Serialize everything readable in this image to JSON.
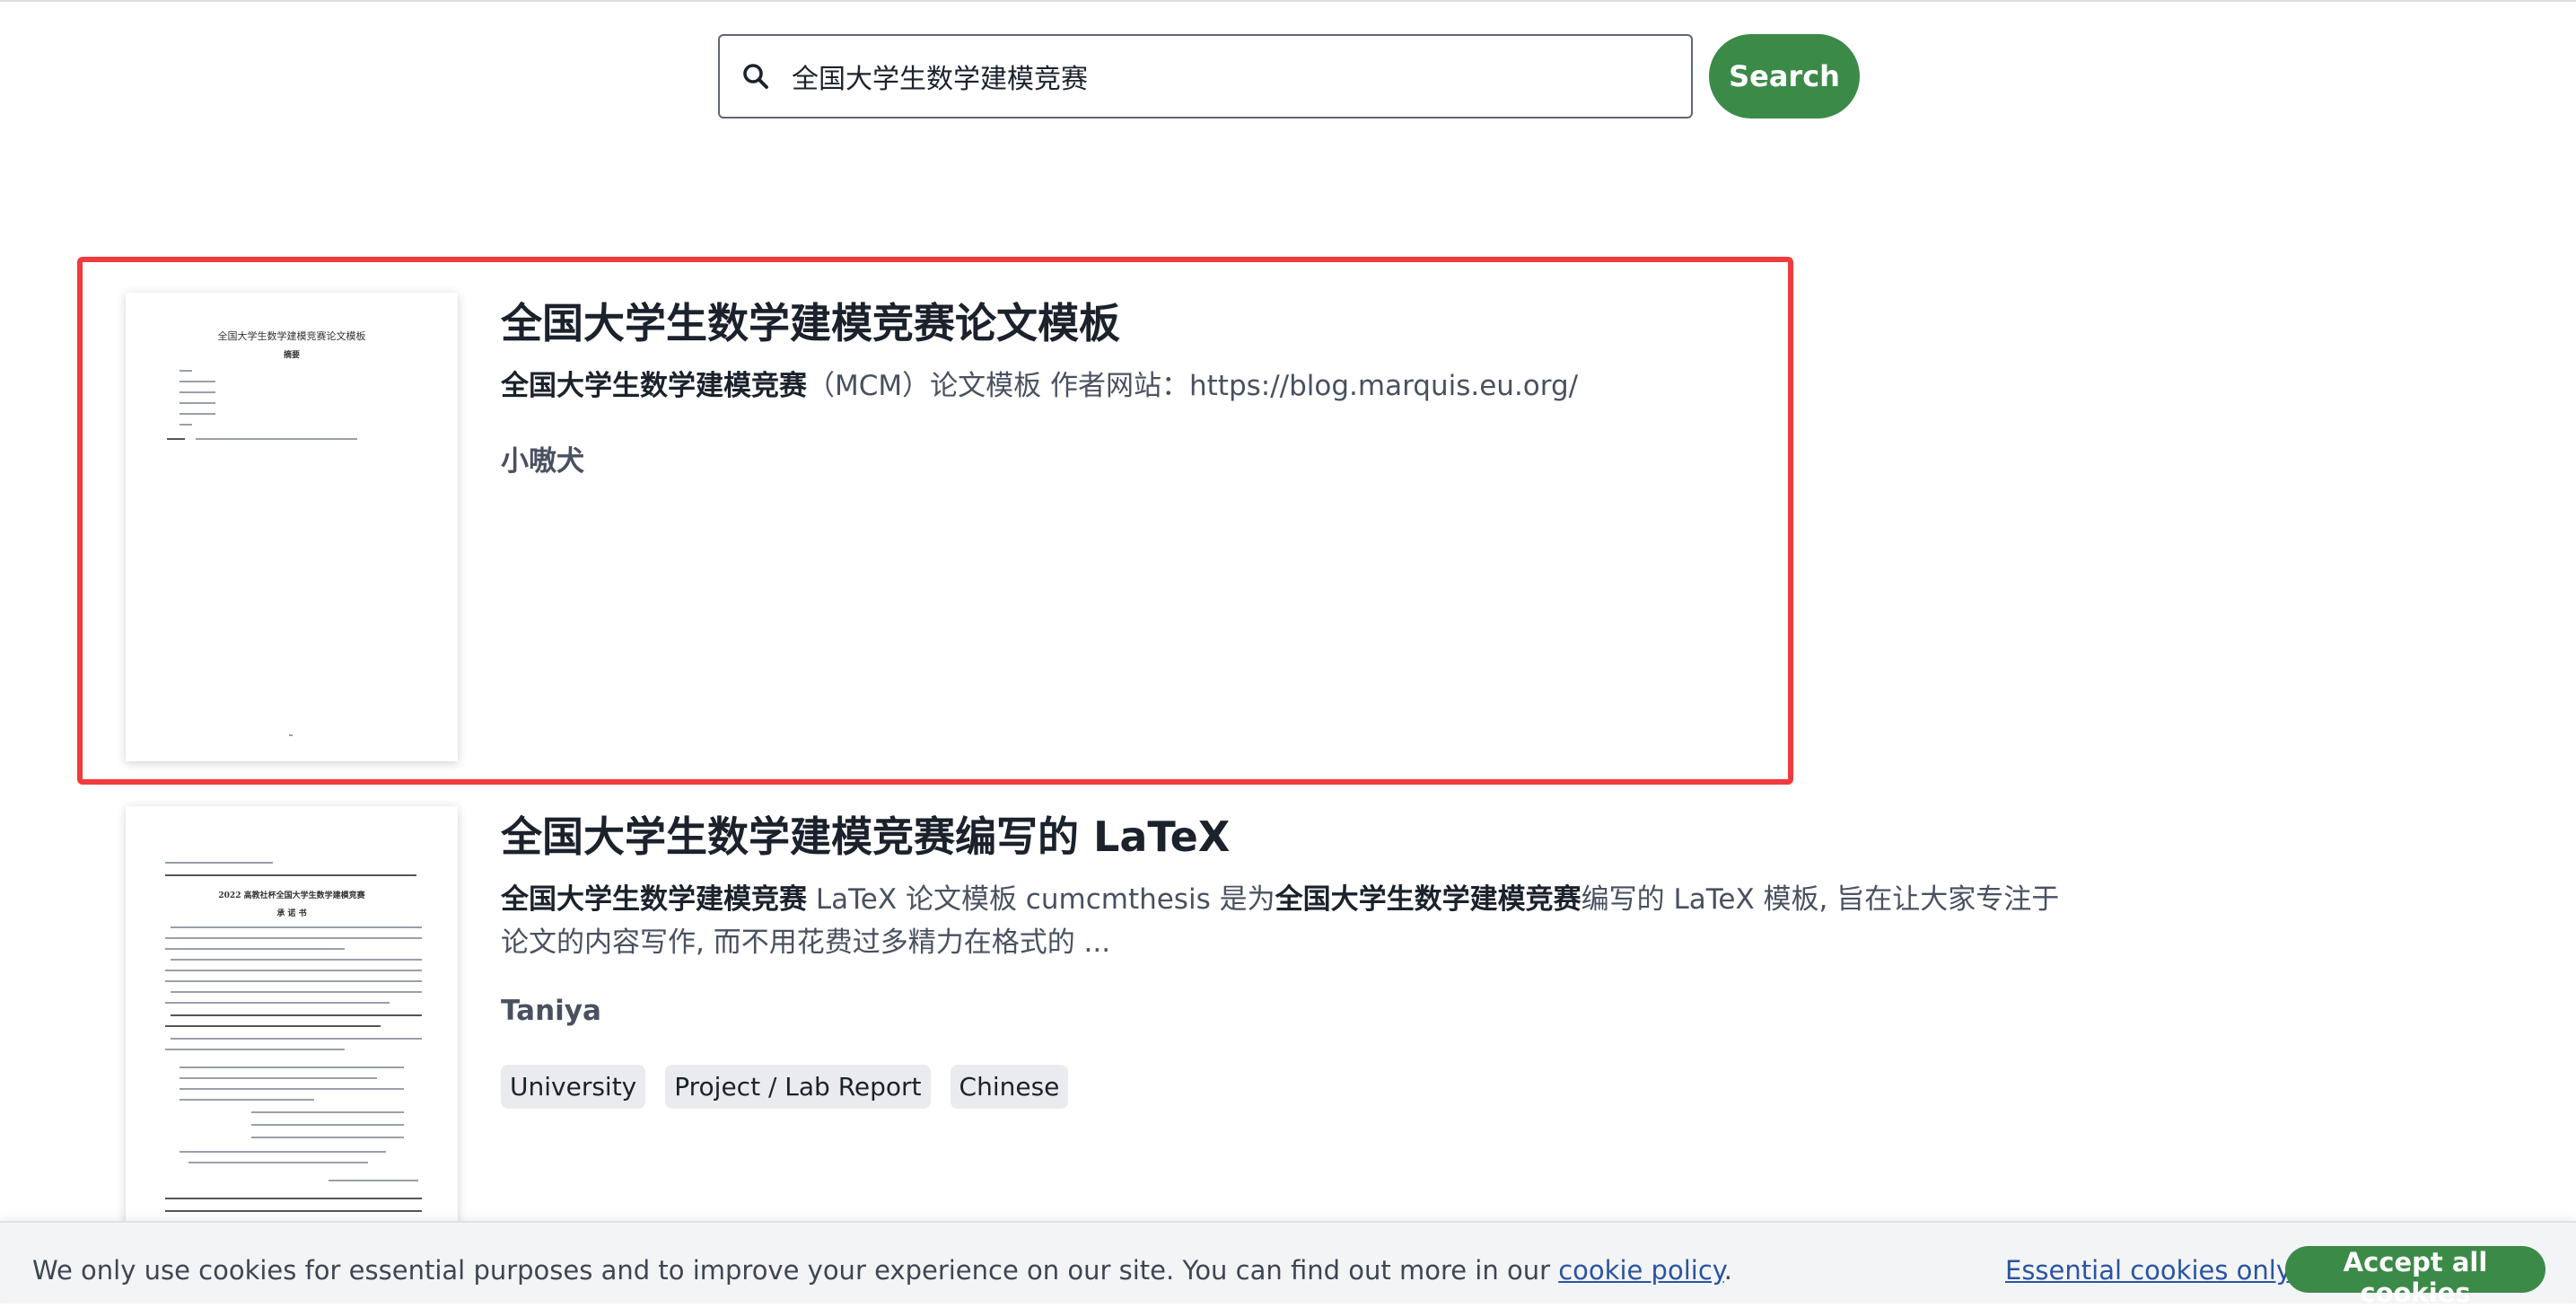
{
  "search": {
    "query": "全国大学生数学建模竞赛",
    "button_label": "Search"
  },
  "results": [
    {
      "title": "全国大学生数学建模竞赛论文模板",
      "description_bold": "全国大学生数学建模竞赛",
      "description_rest": "（MCM）论文模板 作者网站：https://blog.marquis.eu.org/",
      "author": "小嗷犬",
      "thumbnail_heading": "全国大学生数学建模竞赛论文模板",
      "thumbnail_subheading": "摘要"
    },
    {
      "title": "全国大学生数学建模竞赛编写的 LaTeX",
      "description_part1_bold": "全国大学生数学建模竞赛",
      "description_part2": " LaTeX 论文模板 cumcmthesis 是为",
      "description_part3_bold": "全国大学生数学建模竞赛",
      "description_part4": "编写的 LaTeX 模板, 旨在让大家专注于论文的内容写作, 而不用花费过多精力在格式的 ...",
      "author": "Taniya",
      "tags": [
        "University",
        "Project / Lab Report",
        "Chinese"
      ],
      "thumbnail_heading": "2022 高教社杯全国大学生数学建模竞赛",
      "thumbnail_subheading": "承 诺 书"
    }
  ],
  "cookie_banner": {
    "text_before_link": "We only use cookies for essential purposes and to improve your experience on our site. You can find out more in our ",
    "link_text": "cookie policy",
    "text_after_link": ".",
    "essential_label": "Essential cookies only",
    "accept_label": "Accept all cookies"
  },
  "colors": {
    "primary_green": "#3c8a48",
    "highlight_red": "#ef3b3e",
    "link_blue": "#2a54a2"
  }
}
